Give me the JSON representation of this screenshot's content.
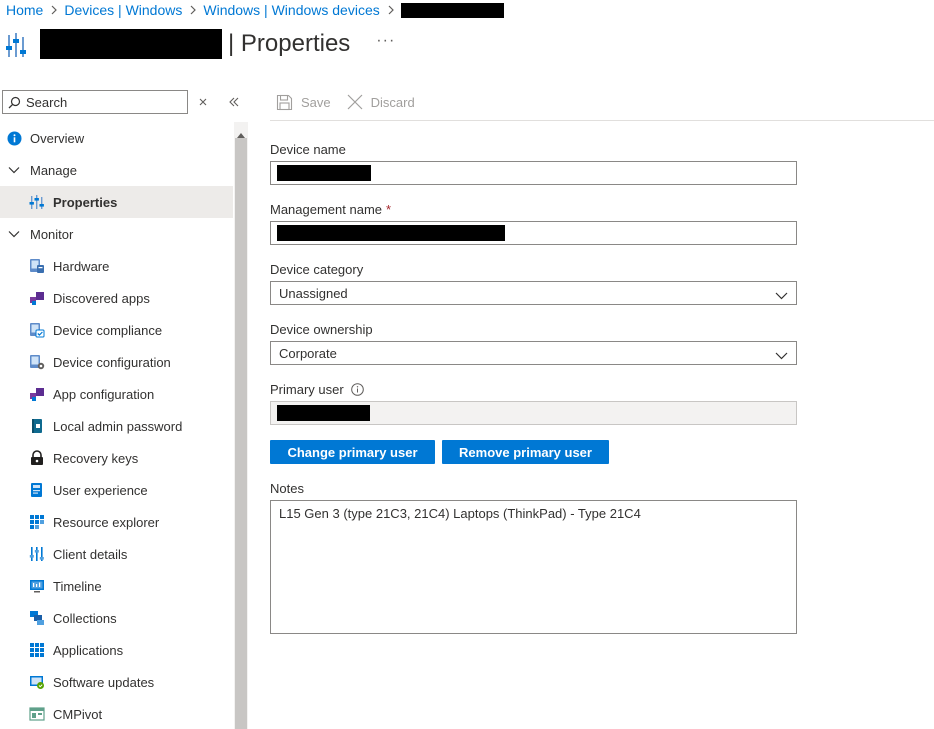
{
  "breadcrumb": {
    "items": [
      "Home",
      "Devices | Windows",
      "Windows | Windows devices"
    ]
  },
  "page": {
    "title": "| Properties",
    "more": "···"
  },
  "search": {
    "placeholder": "Search"
  },
  "nav": {
    "overview": "Overview",
    "manage": "Manage",
    "properties": "Properties",
    "monitor": "Monitor",
    "hardware": "Hardware",
    "discovered_apps": "Discovered apps",
    "device_compliance": "Device compliance",
    "device_configuration": "Device configuration",
    "app_configuration": "App configuration",
    "local_admin_password": "Local admin password",
    "recovery_keys": "Recovery keys",
    "user_experience": "User experience",
    "resource_explorer": "Resource explorer",
    "client_details": "Client details",
    "timeline": "Timeline",
    "collections": "Collections",
    "applications": "Applications",
    "software_updates": "Software updates",
    "cmpivot": "CMPivot"
  },
  "toolbar": {
    "save_label": "Save",
    "discard_label": "Discard"
  },
  "form": {
    "device_name_label": "Device name",
    "management_name_label": "Management name",
    "required_mark": "*",
    "device_category_label": "Device category",
    "device_category_value": "Unassigned",
    "device_ownership_label": "Device ownership",
    "device_ownership_value": "Corporate",
    "primary_user_label": "Primary user",
    "change_primary_user": "Change primary user",
    "remove_primary_user": "Remove primary user",
    "notes_label": "Notes",
    "notes_value": "L15 Gen 3 (type 21C3, 21C4) Laptops (ThinkPad) - Type 21C4"
  },
  "colors": {
    "accent": "#0078d4",
    "selected_bg": "#edebe9",
    "required": "#a4262c"
  }
}
